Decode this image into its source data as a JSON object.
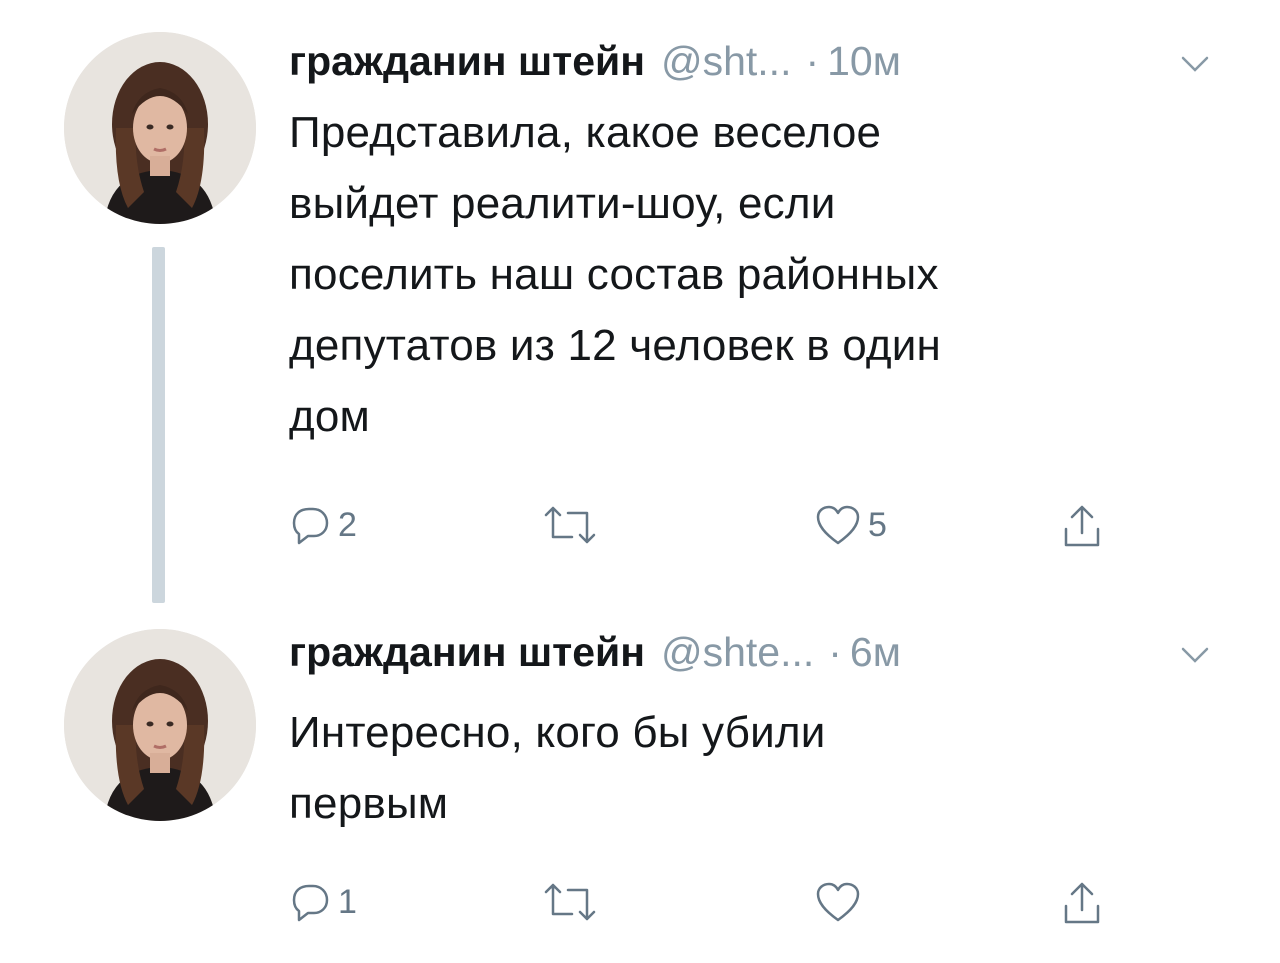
{
  "tweets": [
    {
      "display_name": "гражданин штейн",
      "handle": "@sht...",
      "dot": "·",
      "time": "10м",
      "text": "Представила, какое веселое\nвыйдет реалити-шоу, если\nпоселить наш состав районных\nдепутатов из 12 человек в один\nдом",
      "reply_count": "2",
      "retweet_count": "",
      "like_count": "5"
    },
    {
      "display_name": "гражданин штейн",
      "handle": "@shte...",
      "dot": "·",
      "time": "6м",
      "text": "Интересно, кого бы убили\nпервым",
      "reply_count": "1",
      "retweet_count": "",
      "like_count": ""
    }
  ],
  "icons": {
    "reply": "reply-icon",
    "retweet": "retweet-icon",
    "like": "heart-icon",
    "share": "share-icon",
    "caret": "chevron-down-icon"
  },
  "colors": {
    "text": "#14171a",
    "secondary": "#8899a6",
    "icon": "#657786",
    "thread_line": "#ccd6dd"
  }
}
